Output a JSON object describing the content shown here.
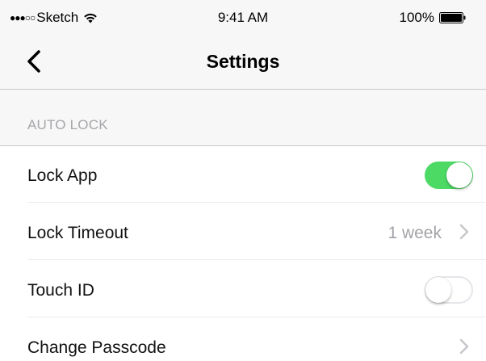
{
  "status_bar": {
    "carrier": "Sketch",
    "signal_dots": "●●●○○",
    "time": "9:41 AM",
    "battery": "100%"
  },
  "nav": {
    "title": "Settings",
    "back_icon": "chevron-left-icon"
  },
  "section": {
    "header": "AUTO LOCK"
  },
  "rows": [
    {
      "label": "Lock App",
      "control": "toggle",
      "on": true
    },
    {
      "label": "Lock Timeout",
      "value": "1 week",
      "control": "disclosure"
    },
    {
      "label": "Touch ID",
      "control": "toggle",
      "on": false
    },
    {
      "label": "Change Passcode",
      "control": "disclosure"
    }
  ],
  "colors": {
    "toggle_on": "#4cd964",
    "bar_background": "#f7f7f7",
    "secondary_text": "#a3a3a8"
  }
}
